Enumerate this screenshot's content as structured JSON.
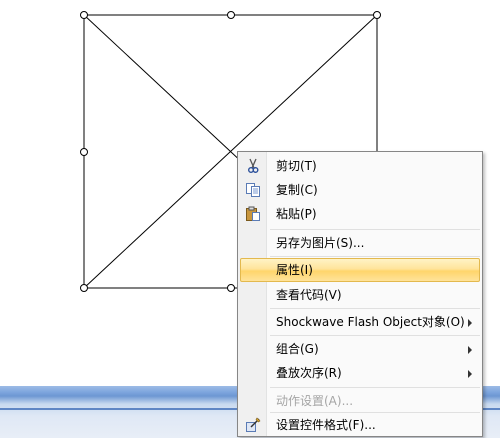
{
  "context_menu": {
    "items": [
      {
        "label": "剪切(T)",
        "icon": "scissors-icon"
      },
      {
        "label": "复制(C)",
        "icon": "copy-icon"
      },
      {
        "label": "粘贴(P)",
        "icon": "paste-icon"
      },
      {
        "label": "另存为图片(S)..."
      },
      {
        "label": "属性(I)",
        "highlighted": true
      },
      {
        "label": "查看代码(V)"
      },
      {
        "label": "Shockwave Flash Object对象(O)",
        "submenu": true
      },
      {
        "label": "组合(G)",
        "submenu": true
      },
      {
        "label": "叠放次序(R)",
        "submenu": true
      },
      {
        "label": "动作设置(A)...",
        "disabled": true
      },
      {
        "label": "设置控件格式(F)...",
        "icon": "format-control-icon"
      }
    ]
  },
  "colors": {
    "highlight": "#ffe49b",
    "menu_border": "#868686",
    "taskbar": "#7ea6de"
  }
}
